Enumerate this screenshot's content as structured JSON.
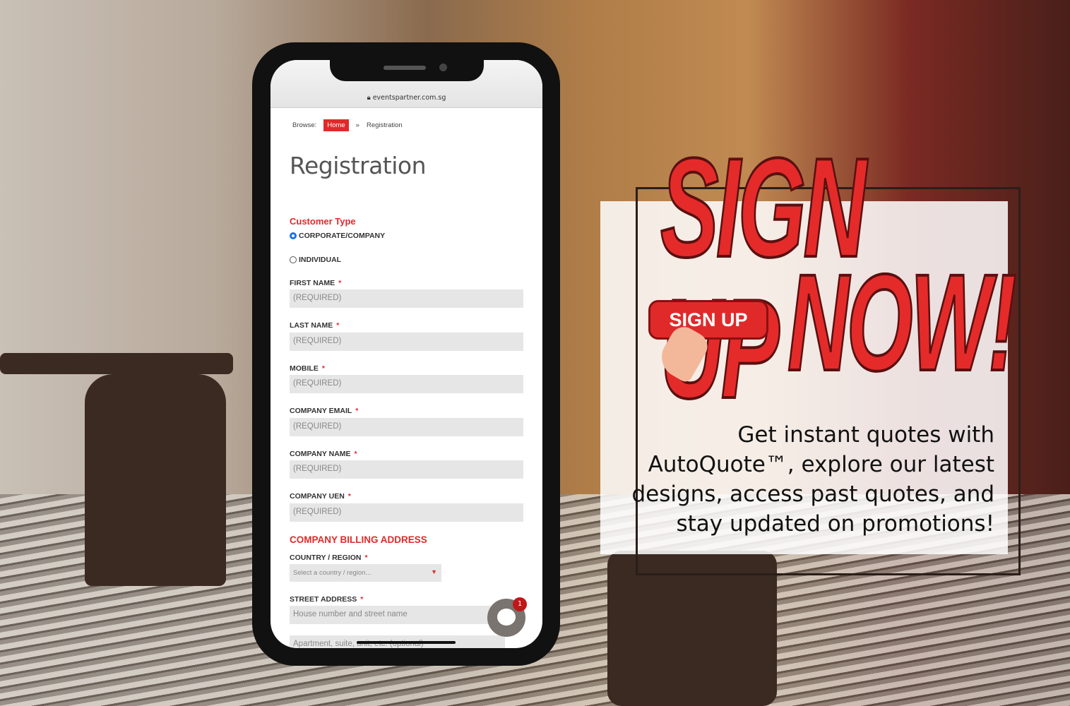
{
  "browser": {
    "url": "eventspartner.com.sg"
  },
  "breadcrumb": {
    "prefix": "Browse:",
    "home": "Home",
    "separator": "»",
    "current": "Registration"
  },
  "page_title": "Registration",
  "customer_type": {
    "label": "Customer Type",
    "options": [
      {
        "label": "CORPORATE/COMPANY",
        "selected": true
      },
      {
        "label": "INDIVIDUAL",
        "selected": false
      }
    ]
  },
  "fields": [
    {
      "label": "FIRST NAME",
      "placeholder": "(REQUIRED)"
    },
    {
      "label": "LAST NAME",
      "placeholder": "(REQUIRED)"
    },
    {
      "label": "MOBILE",
      "placeholder": "(REQUIRED)"
    },
    {
      "label": "COMPANY EMAIL",
      "placeholder": "(REQUIRED)"
    },
    {
      "label": "COMPANY NAME",
      "placeholder": "(REQUIRED)"
    },
    {
      "label": "COMPANY UEN",
      "placeholder": "(REQUIRED)"
    }
  ],
  "required_mark": "*",
  "billing": {
    "heading": "COMPANY BILLING ADDRESS",
    "country_label": "COUNTRY / REGION",
    "country_placeholder": "Select a country / region...",
    "street_label": "STREET ADDRESS",
    "street_placeholder": "House number and street name",
    "apt_placeholder": "Apartment, suite, unit, etc. (optional)"
  },
  "chat": {
    "badge": "1"
  },
  "promo": {
    "headline_1": "SIGN UP",
    "headline_2": "NOW!",
    "button": "SIGN UP",
    "blurb": "Get instant quotes with AutoQuote™, explore our latest designs, access past quotes, and stay updated on promotions!"
  },
  "colors": {
    "accent": "#e02a2a",
    "radio_selected": "#1a73e8"
  }
}
